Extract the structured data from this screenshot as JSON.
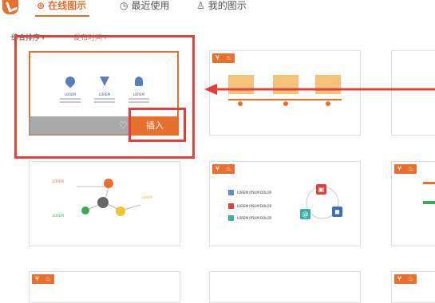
{
  "tabs": [
    {
      "label": "在线图示",
      "icon": "globe-icon",
      "active": true
    },
    {
      "label": "最近使用",
      "icon": "clock-icon",
      "active": false
    },
    {
      "label": "我的图示",
      "icon": "user-icon",
      "active": false
    }
  ],
  "sort": {
    "option1": "综合排序",
    "option2": "发布时间"
  },
  "card1": {
    "item_label": "LOREM",
    "insert_label": "插入"
  },
  "card4": {
    "label": "LOREM"
  },
  "card5": {
    "item_text": "LOREM IPSUM DOLOR"
  },
  "colors": {
    "accent": "#e8702f",
    "annotation": "#e0413a"
  }
}
